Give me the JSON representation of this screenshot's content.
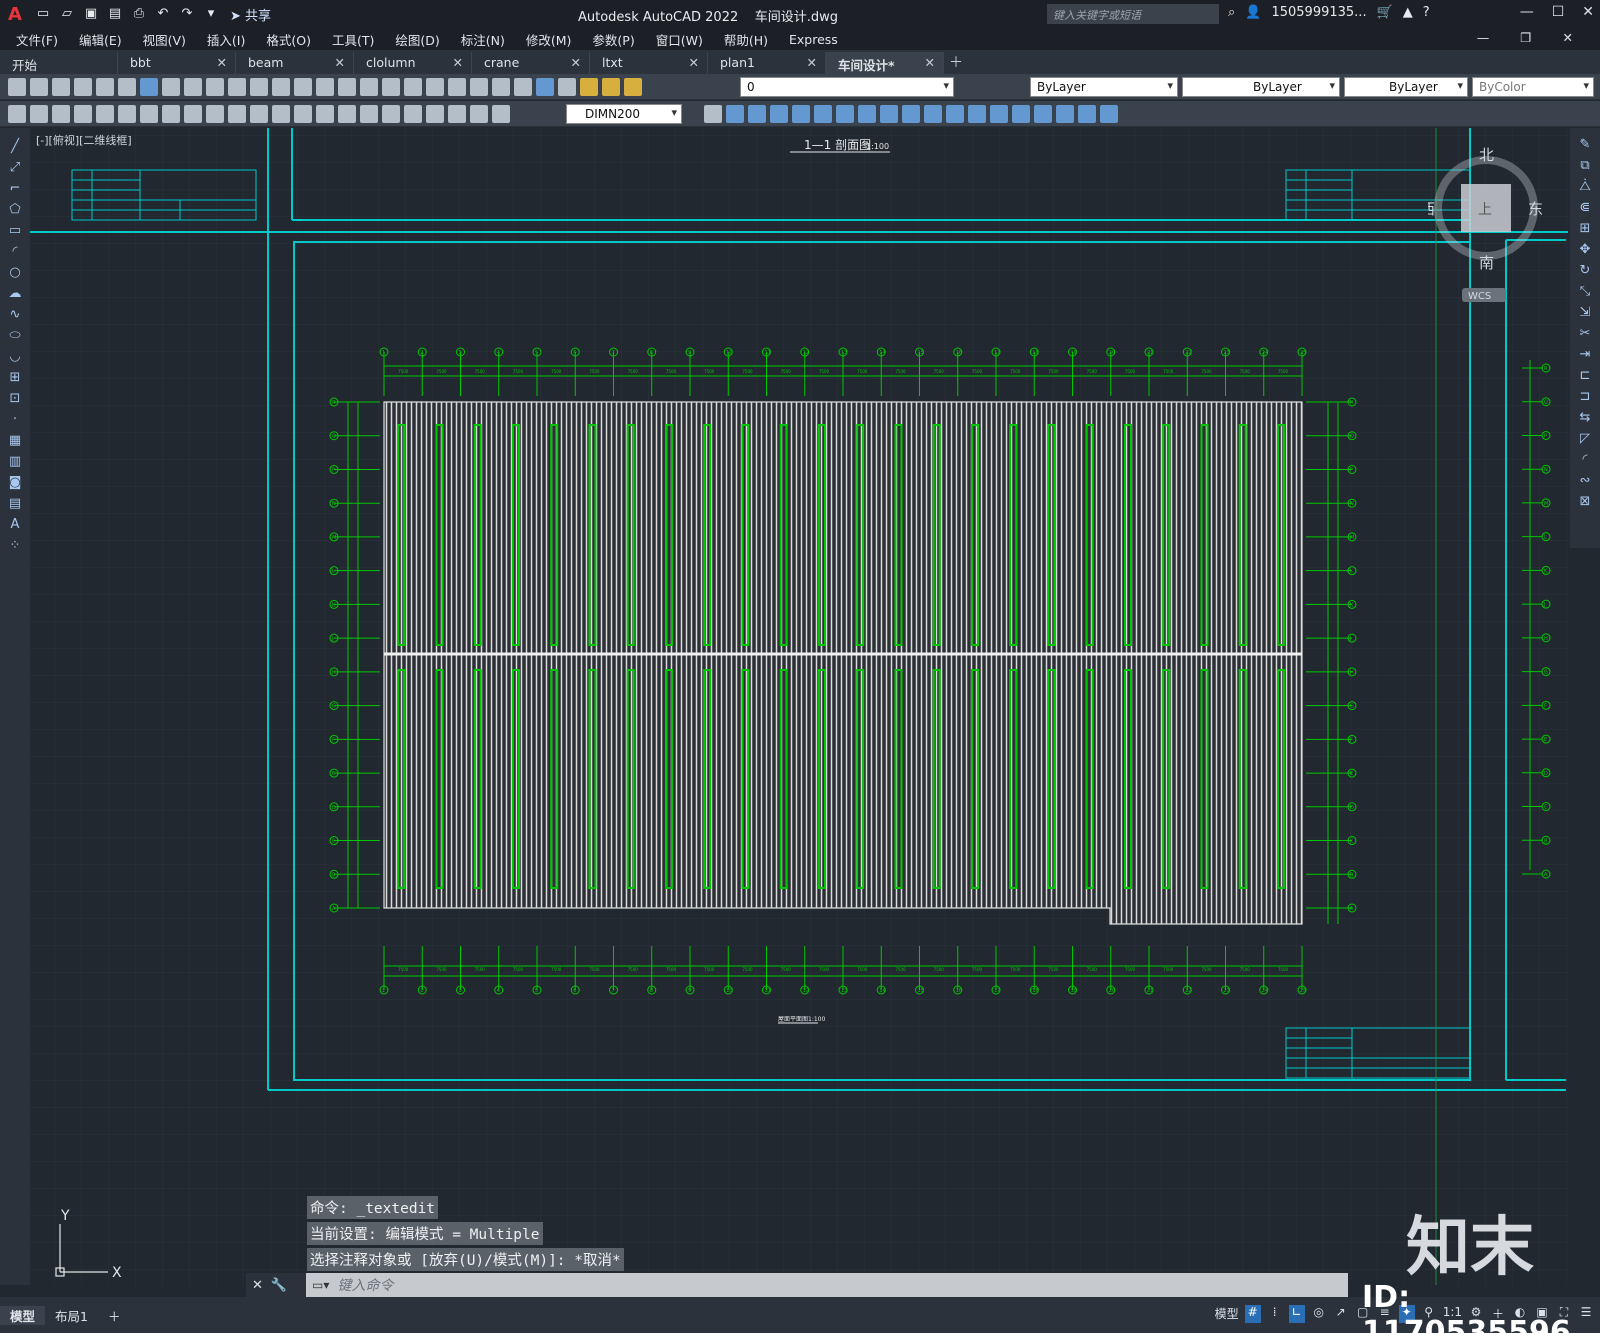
{
  "app": {
    "title": "Autodesk AutoCAD 2022",
    "file": "车间设计.dwg",
    "share": "共享",
    "search_placeholder": "键入关键字或短语",
    "user": "1505999135...",
    "logo": "A"
  },
  "menu": [
    "文件(F)",
    "编辑(E)",
    "视图(V)",
    "插入(I)",
    "格式(O)",
    "工具(T)",
    "绘图(D)",
    "标注(N)",
    "修改(M)",
    "参数(P)",
    "窗口(W)",
    "帮助(H)",
    "Express"
  ],
  "tabs": [
    {
      "label": "开始",
      "close": false
    },
    {
      "label": "bbt",
      "close": true
    },
    {
      "label": "beam",
      "close": true
    },
    {
      "label": "clolumn",
      "close": true
    },
    {
      "label": "crane",
      "close": true
    },
    {
      "label": "ltxt",
      "close": true
    },
    {
      "label": "plan1",
      "close": true
    },
    {
      "label": "车间设计*",
      "close": true,
      "active": true
    }
  ],
  "toolbar": {
    "layer": "0",
    "color": "ByLayer",
    "linetype": "ByLayer",
    "lineweight": "ByLayer",
    "plotstyle": "ByColor",
    "dimstyle": "DIMN200"
  },
  "viewport": {
    "label": "[-][俯视][二维线框]",
    "drawing_title": "1—1 剖面图",
    "drawing_scale": "1:100",
    "plan_title": "屋面平面图1:100"
  },
  "viewcube": {
    "north": "北",
    "south": "南",
    "east": "东",
    "west": "西",
    "face": "上",
    "wcs": "WCS"
  },
  "grid": {
    "columns": [
      "1",
      "2",
      "3",
      "4",
      "5",
      "6",
      "7",
      "8",
      "9",
      "10",
      "11",
      "12",
      "13",
      "14",
      "15",
      "16",
      "17",
      "18",
      "19",
      "20",
      "21",
      "22",
      "23",
      "24",
      "25"
    ],
    "rows": [
      "R",
      "Q",
      "P",
      "N",
      "M",
      "L",
      "K",
      "J",
      "H",
      "G",
      "F",
      "E",
      "D",
      "C",
      "B",
      "A"
    ],
    "bay_dim": "7500"
  },
  "command": {
    "history": [
      "命令: _textedit",
      "当前设置: 编辑模式 = Multiple",
      "选择注释对象或 [放弃(U)/模式(M)]: *取消*"
    ],
    "prompt": "键入命令"
  },
  "layouts": [
    "模型",
    "布局1"
  ],
  "status": {
    "model": "模型",
    "scale": "1:1"
  },
  "watermark": {
    "logo": "知末",
    "id": "ID: 1170535596"
  },
  "colors": {
    "grid_line": "#00c800",
    "frame": "#00c9c9",
    "roof": "#d8d8d8",
    "bg": "#212830"
  }
}
